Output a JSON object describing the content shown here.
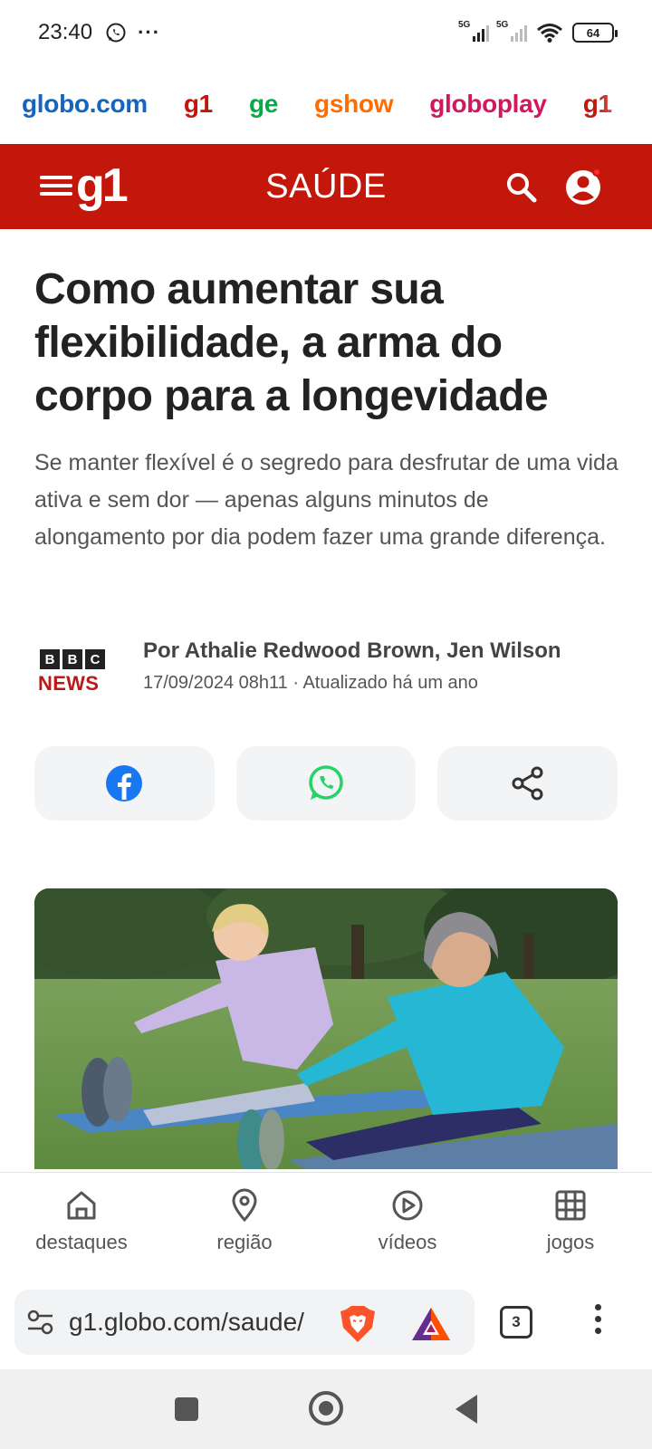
{
  "status_bar": {
    "time": "23:40",
    "more": "···",
    "net1": "5G",
    "net2": "5G",
    "battery": "64"
  },
  "globo_nav": {
    "items": [
      {
        "label": "globo.com",
        "color": "#1565c0"
      },
      {
        "label": "g1",
        "color": "#c4170c"
      },
      {
        "label": "ge",
        "color": "#06aa48"
      },
      {
        "label": "gshow",
        "color": "#ff6c00"
      },
      {
        "label": "globoplay",
        "color": "#d0185f"
      },
      {
        "label": "g1",
        "color": "#c4170c"
      }
    ]
  },
  "header": {
    "logo": "g1",
    "section": "SAÚDE",
    "color": "#c4170c"
  },
  "article": {
    "title": "Como aumentar sua flexibilidade, a arma do corpo para a longevidade",
    "subtitle": "Se manter flexível é o segredo para desfrutar de uma vida ativa e sem dor — apenas alguns minutos de alongamento por dia podem fazer uma grande diferença.",
    "source_logo": {
      "boxes": [
        "B",
        "B",
        "C"
      ],
      "news": "NEWS"
    },
    "author": "Por Athalie Redwood Brown, Jen Wilson",
    "date": "17/09/2024 08h11 · Atualizado há um ano"
  },
  "share": {
    "icons": [
      "facebook-icon",
      "whatsapp-icon",
      "share-icon"
    ]
  },
  "tab_bar": {
    "items": [
      {
        "label": "destaques",
        "icon": "home-icon"
      },
      {
        "label": "região",
        "icon": "location-pin-icon"
      },
      {
        "label": "vídeos",
        "icon": "play-circle-icon"
      },
      {
        "label": "jogos",
        "icon": "grid-icon"
      }
    ]
  },
  "browser": {
    "url": "g1.globo.com/saude/",
    "tab_count": "3"
  }
}
